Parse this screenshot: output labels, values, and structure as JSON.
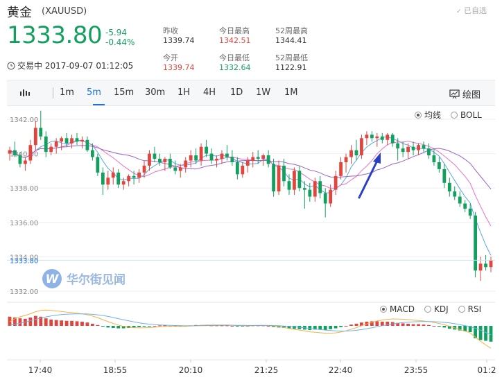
{
  "header": {
    "title": "黄金",
    "code": "(XAUUSD)",
    "selected_label": "已自选",
    "price": "1333.80",
    "change": "-5.94",
    "change_pct": "-0.44%",
    "status": "交易中 2017-09-07 01:12:05"
  },
  "stats": [
    {
      "label": "昨收",
      "value": "1339.74",
      "color": "dark"
    },
    {
      "label": "今日最高",
      "value": "1342.51",
      "color": "red"
    },
    {
      "label": "52周最高",
      "value": "1344.41",
      "color": "dark"
    },
    {
      "label": "今开",
      "value": "1339.74",
      "color": "red"
    },
    {
      "label": "今日最低",
      "value": "1332.64",
      "color": "green"
    },
    {
      "label": "52周最低",
      "value": "1122.91",
      "color": "dark"
    }
  ],
  "toolbar": {
    "intervals": [
      "1m",
      "5m",
      "15m",
      "30m",
      "1H",
      "4H",
      "1D",
      "1W",
      "1M"
    ],
    "active_interval": "5m",
    "draw_label": "绘图"
  },
  "overlay_options": {
    "main": [
      {
        "label": "均线",
        "checked": true
      },
      {
        "label": "BOLL",
        "checked": false
      }
    ],
    "indicator": [
      {
        "label": "MACD",
        "checked": true
      },
      {
        "label": "KDJ",
        "checked": false
      },
      {
        "label": "RSI",
        "checked": false
      }
    ]
  },
  "watermark": "华尔街见闻",
  "current_price_tag": "1333.80",
  "colors": {
    "up": "#e0463e",
    "down": "#13a05f",
    "accent": "#1a73d9",
    "ma5": "#5aa6e6",
    "ma10": "#e870c8",
    "ma20": "#9a62c8"
  },
  "chart_data": {
    "type": "candlestick",
    "y_ticks": [
      "1342.00",
      "1340.00",
      "1338.00",
      "1336.00",
      "1334.00",
      "1332.00"
    ],
    "ylim": [
      1332,
      1342
    ],
    "x_ticks": [
      "17:40",
      "18:55",
      "20:10",
      "21:25",
      "22:40",
      "23:55",
      "01:2"
    ],
    "candles": [
      [
        1340.0,
        1340.4,
        1339.6,
        1340.2
      ],
      [
        1340.2,
        1340.7,
        1339.8,
        1339.9
      ],
      [
        1339.9,
        1340.1,
        1339.2,
        1339.4
      ],
      [
        1339.4,
        1339.8,
        1339.0,
        1339.6
      ],
      [
        1339.6,
        1340.8,
        1339.4,
        1340.5
      ],
      [
        1340.5,
        1341.9,
        1340.2,
        1341.5
      ],
      [
        1341.5,
        1342.5,
        1340.8,
        1341.0
      ],
      [
        1341.0,
        1341.3,
        1339.8,
        1340.1
      ],
      [
        1340.1,
        1340.6,
        1339.9,
        1340.4
      ],
      [
        1340.4,
        1340.9,
        1340.0,
        1340.7
      ],
      [
        1340.7,
        1341.0,
        1340.2,
        1340.9
      ],
      [
        1340.9,
        1341.2,
        1340.4,
        1340.6
      ],
      [
        1340.6,
        1341.1,
        1340.3,
        1340.9
      ],
      [
        1340.9,
        1341.2,
        1340.5,
        1340.7
      ],
      [
        1340.7,
        1341.0,
        1340.3,
        1340.8
      ],
      [
        1340.8,
        1341.0,
        1340.1,
        1340.2
      ],
      [
        1340.2,
        1340.6,
        1339.6,
        1339.8
      ],
      [
        1339.8,
        1340.0,
        1338.7,
        1338.9
      ],
      [
        1338.9,
        1339.2,
        1337.6,
        1338.2
      ],
      [
        1338.2,
        1339.0,
        1337.9,
        1338.6
      ],
      [
        1338.6,
        1339.2,
        1338.2,
        1338.9
      ],
      [
        1338.9,
        1339.1,
        1338.0,
        1338.2
      ],
      [
        1338.2,
        1338.6,
        1337.9,
        1338.4
      ],
      [
        1338.4,
        1338.8,
        1338.1,
        1338.7
      ],
      [
        1338.7,
        1339.0,
        1338.2,
        1338.6
      ],
      [
        1338.6,
        1339.1,
        1338.3,
        1338.9
      ],
      [
        1338.9,
        1339.6,
        1338.6,
        1339.3
      ],
      [
        1339.3,
        1340.2,
        1339.0,
        1340.0
      ],
      [
        1340.0,
        1340.4,
        1339.5,
        1339.7
      ],
      [
        1339.7,
        1340.0,
        1339.3,
        1339.5
      ],
      [
        1339.5,
        1339.8,
        1339.0,
        1339.7
      ],
      [
        1339.7,
        1340.0,
        1339.1,
        1339.2
      ],
      [
        1339.2,
        1339.6,
        1338.8,
        1339.0
      ],
      [
        1339.0,
        1339.4,
        1338.6,
        1339.2
      ],
      [
        1339.2,
        1339.8,
        1338.9,
        1339.6
      ],
      [
        1339.6,
        1340.2,
        1339.2,
        1339.9
      ],
      [
        1339.9,
        1340.3,
        1339.4,
        1339.6
      ],
      [
        1339.6,
        1340.6,
        1339.3,
        1340.4
      ],
      [
        1340.4,
        1340.8,
        1339.8,
        1340.0
      ],
      [
        1340.0,
        1340.3,
        1339.4,
        1339.6
      ],
      [
        1339.6,
        1339.9,
        1339.2,
        1339.7
      ],
      [
        1339.7,
        1340.2,
        1339.4,
        1340.0
      ],
      [
        1340.0,
        1340.5,
        1339.6,
        1339.8
      ],
      [
        1339.8,
        1340.2,
        1339.3,
        1339.5
      ],
      [
        1339.5,
        1339.8,
        1338.5,
        1338.8
      ],
      [
        1338.8,
        1339.5,
        1338.6,
        1339.3
      ],
      [
        1339.3,
        1339.8,
        1338.9,
        1339.6
      ],
      [
        1339.6,
        1340.1,
        1339.2,
        1339.8
      ],
      [
        1339.8,
        1340.2,
        1339.4,
        1339.7
      ],
      [
        1339.7,
        1340.0,
        1339.3,
        1339.9
      ],
      [
        1339.9,
        1340.2,
        1339.2,
        1339.4
      ],
      [
        1339.4,
        1339.7,
        1337.5,
        1337.8
      ],
      [
        1337.8,
        1339.6,
        1337.6,
        1339.3
      ],
      [
        1339.3,
        1339.7,
        1338.1,
        1338.4
      ],
      [
        1338.4,
        1338.8,
        1337.6,
        1337.9
      ],
      [
        1337.9,
        1339.2,
        1337.6,
        1339.0
      ],
      [
        1339.0,
        1339.3,
        1337.8,
        1338.0
      ],
      [
        1338.0,
        1338.4,
        1336.8,
        1337.9
      ],
      [
        1337.9,
        1338.3,
        1337.2,
        1337.5
      ],
      [
        1337.5,
        1338.6,
        1337.2,
        1338.4
      ],
      [
        1338.4,
        1338.7,
        1337.4,
        1337.7
      ],
      [
        1337.7,
        1338.0,
        1336.3,
        1337.1
      ],
      [
        1337.1,
        1338.2,
        1336.9,
        1337.9
      ],
      [
        1337.9,
        1339.0,
        1337.6,
        1338.7
      ],
      [
        1338.7,
        1339.8,
        1338.5,
        1339.5
      ],
      [
        1339.5,
        1340.0,
        1338.9,
        1339.8
      ],
      [
        1339.8,
        1340.5,
        1339.4,
        1340.2
      ],
      [
        1340.2,
        1340.8,
        1339.6,
        1339.9
      ],
      [
        1339.9,
        1341.1,
        1339.7,
        1340.9
      ],
      [
        1340.9,
        1341.3,
        1340.5,
        1341.1
      ],
      [
        1341.1,
        1341.3,
        1340.7,
        1340.9
      ],
      [
        1340.9,
        1341.2,
        1340.4,
        1341.0
      ],
      [
        1341.0,
        1341.2,
        1340.6,
        1340.8
      ],
      [
        1340.8,
        1341.2,
        1340.5,
        1341.1
      ],
      [
        1341.1,
        1341.2,
        1340.4,
        1340.6
      ],
      [
        1340.6,
        1340.9,
        1339.6,
        1340.3
      ],
      [
        1340.3,
        1340.7,
        1339.8,
        1340.1
      ],
      [
        1340.1,
        1340.6,
        1339.7,
        1340.4
      ],
      [
        1340.4,
        1340.7,
        1339.9,
        1340.2
      ],
      [
        1340.2,
        1340.6,
        1339.9,
        1340.5
      ],
      [
        1340.5,
        1340.7,
        1340.1,
        1340.3
      ],
      [
        1340.3,
        1340.6,
        1339.7,
        1339.9
      ],
      [
        1339.9,
        1340.3,
        1339.3,
        1339.5
      ],
      [
        1339.5,
        1339.8,
        1338.9,
        1339.1
      ],
      [
        1339.1,
        1339.4,
        1338.0,
        1338.3
      ],
      [
        1338.3,
        1338.6,
        1337.5,
        1337.8
      ],
      [
        1337.8,
        1338.1,
        1337.3,
        1337.5
      ],
      [
        1337.5,
        1337.8,
        1336.9,
        1337.1
      ],
      [
        1337.1,
        1337.3,
        1336.6,
        1336.8
      ],
      [
        1336.8,
        1337.1,
        1336.2,
        1336.4
      ],
      [
        1336.4,
        1336.6,
        1332.8,
        1333.2
      ],
      [
        1333.2,
        1334.0,
        1332.6,
        1333.6
      ],
      [
        1333.6,
        1334.1,
        1333.2,
        1333.4
      ],
      [
        1333.4,
        1334.0,
        1333.1,
        1333.8
      ]
    ],
    "macd_hist": [
      0.22,
      0.2,
      0.18,
      0.17,
      0.2,
      0.24,
      0.22,
      0.18,
      0.15,
      0.14,
      0.13,
      0.12,
      0.12,
      0.11,
      0.1,
      0.08,
      0.05,
      0.02,
      -0.02,
      -0.04,
      -0.05,
      -0.06,
      -0.06,
      -0.05,
      -0.04,
      -0.03,
      -0.02,
      -0.01,
      0.0,
      0.01,
      0.01,
      0.0,
      -0.01,
      -0.01,
      0.0,
      0.01,
      0.02,
      0.02,
      0.02,
      0.01,
      0.01,
      0.01,
      0.01,
      0.0,
      -0.01,
      -0.01,
      0.0,
      0.01,
      0.01,
      0.01,
      0.0,
      -0.03,
      -0.04,
      -0.05,
      -0.07,
      -0.07,
      -0.08,
      -0.09,
      -0.1,
      -0.09,
      -0.09,
      -0.1,
      -0.08,
      -0.06,
      -0.03,
      0.0,
      0.03,
      0.05,
      0.08,
      0.1,
      0.11,
      0.11,
      0.1,
      0.1,
      0.09,
      0.07,
      0.06,
      0.05,
      0.04,
      0.04,
      0.03,
      0.02,
      0.0,
      -0.02,
      -0.04,
      -0.07,
      -0.09,
      -0.11,
      -0.13,
      -0.15,
      -0.3,
      -0.34,
      -0.36,
      -0.38
    ]
  }
}
